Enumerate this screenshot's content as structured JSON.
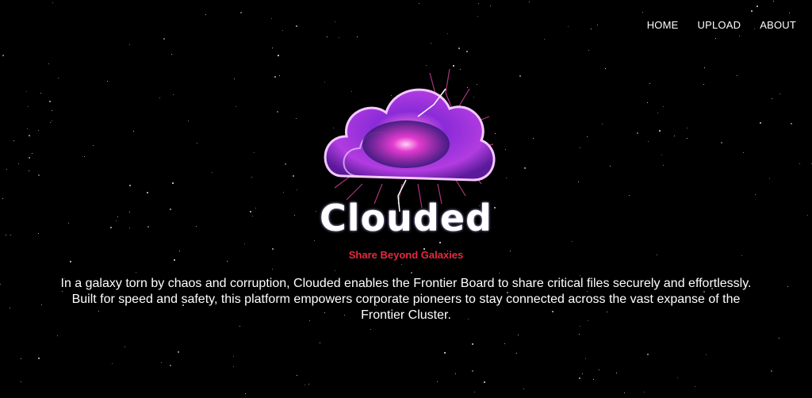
{
  "nav": {
    "items": [
      {
        "label": "HOME"
      },
      {
        "label": "UPLOAD"
      },
      {
        "label": "ABOUT"
      }
    ]
  },
  "hero": {
    "logo_icon": "galaxy-cloud-icon",
    "title": "Clouded",
    "tagline": "Share Beyond Galaxies",
    "description": "In a galaxy torn by chaos and corruption, Clouded enables the Frontier Board to share critical files securely and effortlessly. Built for speed and safety, this platform empowers corporate pioneers to stay connected across the vast expanse of the Frontier Cluster."
  },
  "colors": {
    "background": "#000000",
    "tagline": "#e8283f",
    "cloud": "#b23ce0"
  }
}
